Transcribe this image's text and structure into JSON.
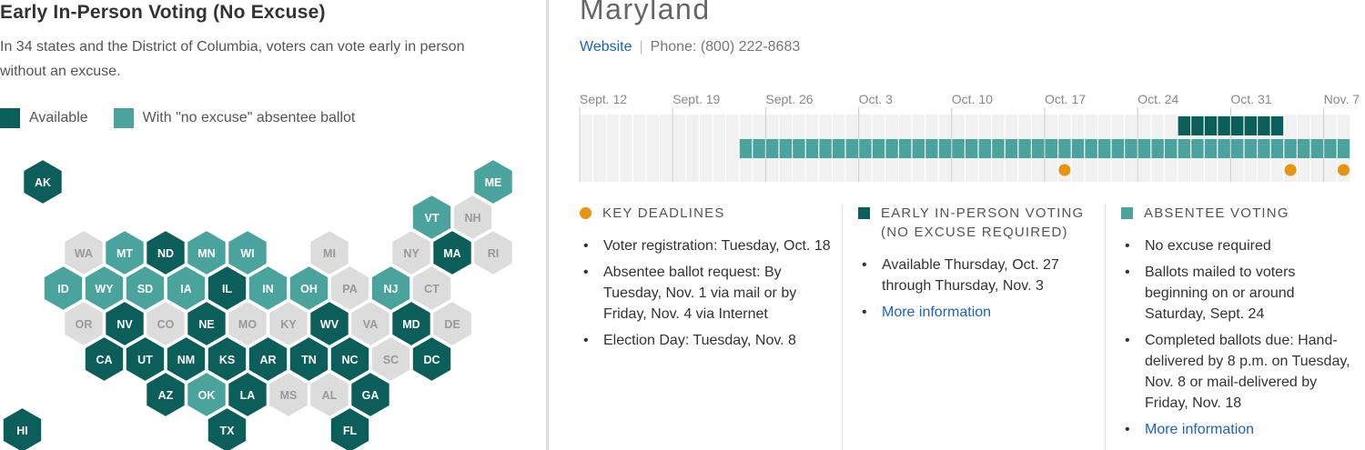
{
  "left": {
    "title": "Early In-Person Voting (No Excuse)",
    "description": "In 34 states and the District of Columbia, voters can vote early in person without an excuse.",
    "legend": [
      {
        "label": "Available",
        "color": "#0c5e5a"
      },
      {
        "label": "With \"no excuse\" absentee ballot",
        "color": "#4ba39e"
      }
    ]
  },
  "colors": {
    "dark": "#0c5e5a",
    "light": "#4ba39e",
    "none": "#dcdcdc",
    "none_text": "#999999",
    "deadline": "#e8940f",
    "link": "#1c62c9"
  },
  "hexmap": {
    "states": [
      {
        "abbr": "AK",
        "status": "dark"
      },
      {
        "abbr": "ME",
        "status": "light"
      },
      {
        "abbr": "VT",
        "status": "light"
      },
      {
        "abbr": "NH",
        "status": "none"
      },
      {
        "abbr": "WA",
        "status": "none"
      },
      {
        "abbr": "MT",
        "status": "light"
      },
      {
        "abbr": "ND",
        "status": "dark"
      },
      {
        "abbr": "MN",
        "status": "light"
      },
      {
        "abbr": "WI",
        "status": "light"
      },
      {
        "abbr": "MI",
        "status": "none"
      },
      {
        "abbr": "NY",
        "status": "none"
      },
      {
        "abbr": "MA",
        "status": "dark"
      },
      {
        "abbr": "RI",
        "status": "none"
      },
      {
        "abbr": "ID",
        "status": "light"
      },
      {
        "abbr": "WY",
        "status": "light"
      },
      {
        "abbr": "SD",
        "status": "light"
      },
      {
        "abbr": "IA",
        "status": "light"
      },
      {
        "abbr": "IL",
        "status": "dark"
      },
      {
        "abbr": "IN",
        "status": "light"
      },
      {
        "abbr": "OH",
        "status": "light"
      },
      {
        "abbr": "PA",
        "status": "none"
      },
      {
        "abbr": "NJ",
        "status": "light"
      },
      {
        "abbr": "CT",
        "status": "none"
      },
      {
        "abbr": "OR",
        "status": "none"
      },
      {
        "abbr": "NV",
        "status": "dark"
      },
      {
        "abbr": "CO",
        "status": "none"
      },
      {
        "abbr": "NE",
        "status": "dark"
      },
      {
        "abbr": "MO",
        "status": "none"
      },
      {
        "abbr": "KY",
        "status": "none"
      },
      {
        "abbr": "WV",
        "status": "dark"
      },
      {
        "abbr": "VA",
        "status": "none"
      },
      {
        "abbr": "MD",
        "status": "dark"
      },
      {
        "abbr": "DE",
        "status": "none"
      },
      {
        "abbr": "CA",
        "status": "dark"
      },
      {
        "abbr": "UT",
        "status": "dark"
      },
      {
        "abbr": "NM",
        "status": "dark"
      },
      {
        "abbr": "KS",
        "status": "dark"
      },
      {
        "abbr": "AR",
        "status": "dark"
      },
      {
        "abbr": "TN",
        "status": "dark"
      },
      {
        "abbr": "NC",
        "status": "dark"
      },
      {
        "abbr": "SC",
        "status": "none"
      },
      {
        "abbr": "DC",
        "status": "dark"
      },
      {
        "abbr": "AZ",
        "status": "dark"
      },
      {
        "abbr": "OK",
        "status": "light"
      },
      {
        "abbr": "LA",
        "status": "dark"
      },
      {
        "abbr": "MS",
        "status": "none"
      },
      {
        "abbr": "AL",
        "status": "none"
      },
      {
        "abbr": "GA",
        "status": "dark"
      },
      {
        "abbr": "HI",
        "status": "dark"
      },
      {
        "abbr": "TX",
        "status": "dark"
      },
      {
        "abbr": "FL",
        "status": "dark"
      }
    ]
  },
  "detail": {
    "state_name": "Maryland",
    "website_label": "Website",
    "phone": "Phone: (800) 222-8683",
    "timeline": {
      "ticks": [
        "Sept. 12",
        "Sept. 19",
        "Sept. 26",
        "Oct. 3",
        "Oct. 10",
        "Oct. 17",
        "Oct. 24",
        "Oct. 31",
        "Nov. 7"
      ],
      "first_day": "Sept. 12",
      "early_voting": {
        "start": "Oct. 27",
        "end": "Nov. 3"
      },
      "absentee": {
        "start": "Sept. 24",
        "end": "Nov. 8"
      },
      "deadlines": [
        "Oct. 18",
        "Nov. 4",
        "Nov. 8"
      ]
    },
    "columns": [
      {
        "heading": "Key Deadlines",
        "items": [
          {
            "text": "Voter registration: Tuesday, Oct. 18"
          },
          {
            "text": "Absentee ballot request: By Tuesday, Nov. 1 via mail or by Friday, Nov. 4 via Internet"
          },
          {
            "text": "Election Day: Tuesday, Nov. 8"
          }
        ]
      },
      {
        "heading": "Early In-Person Voting (No Excuse Required)",
        "items": [
          {
            "text": "Available Thursday, Oct. 27 through Thursday, Nov. 3"
          },
          {
            "text": "More information",
            "link": true
          }
        ]
      },
      {
        "heading": "Absentee Voting",
        "items": [
          {
            "text": "No excuse required"
          },
          {
            "text": "Ballots mailed to voters beginning on or around Saturday, Sept. 24"
          },
          {
            "text": "Completed ballots due: Hand-delivered by 8 p.m. on Tuesday, Nov. 8 or mail-delivered by Friday, Nov. 18"
          },
          {
            "text": "More information",
            "link": true
          }
        ]
      }
    ]
  }
}
